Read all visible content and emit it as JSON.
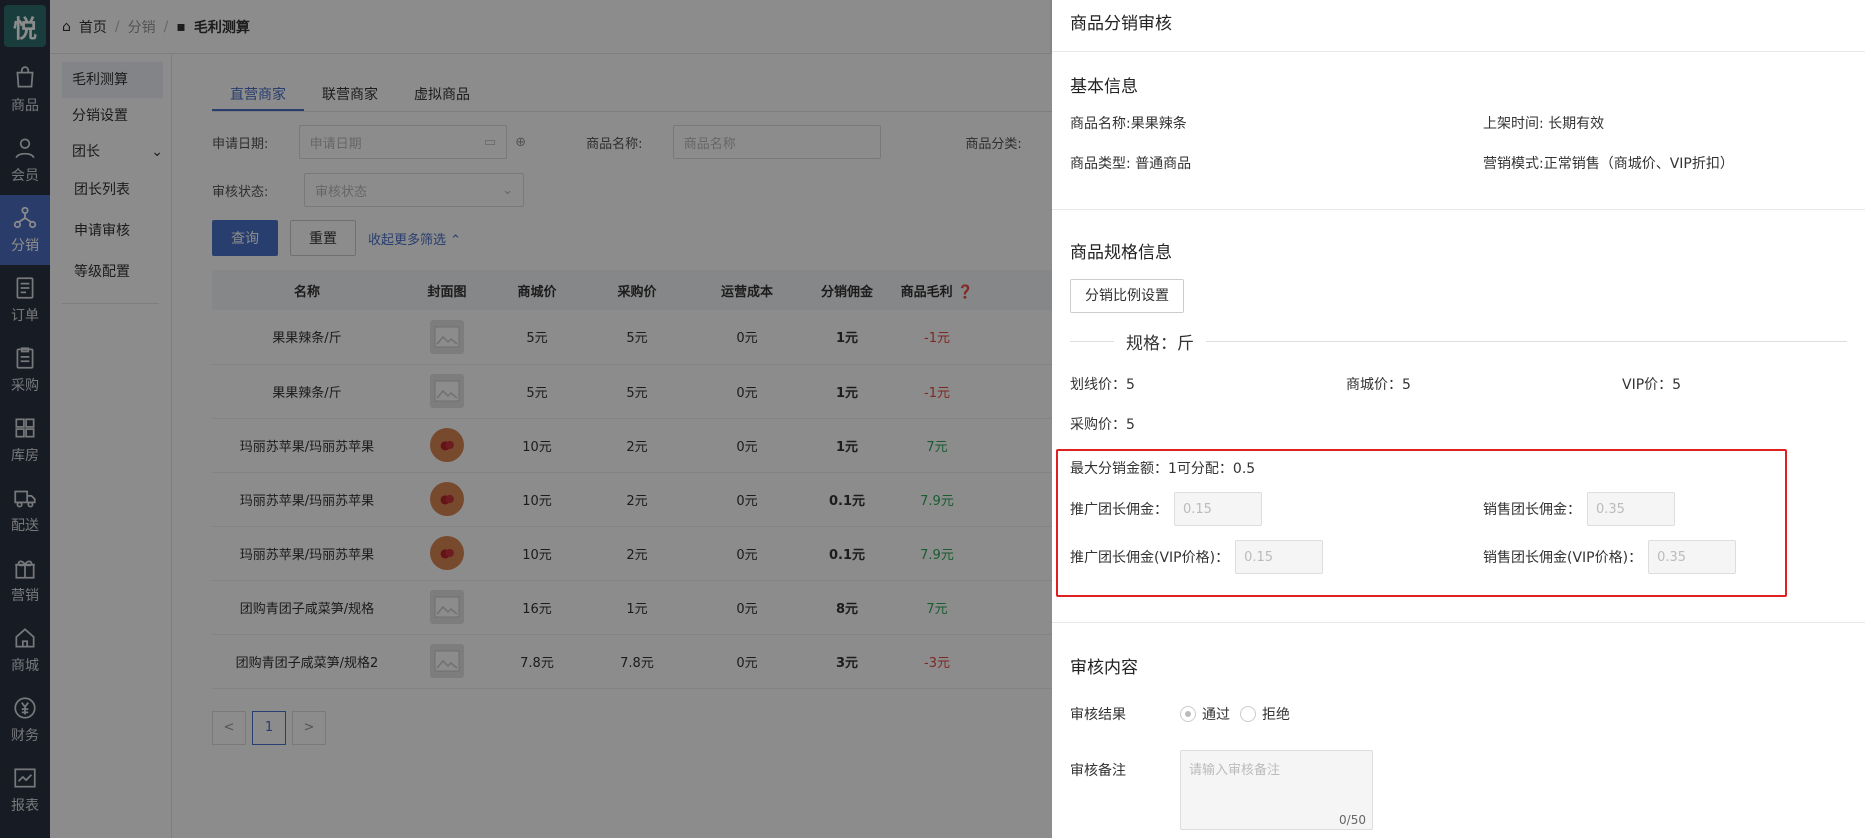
{
  "app": {
    "logo_text": "悦"
  },
  "iconbar": [
    {
      "label": "商品",
      "icon": "bag-icon"
    },
    {
      "label": "会员",
      "icon": "user-icon"
    },
    {
      "label": "分销",
      "icon": "share-icon",
      "active": true
    },
    {
      "label": "订单",
      "icon": "doc-icon"
    },
    {
      "label": "采购",
      "icon": "clipboard-icon"
    },
    {
      "label": "库房",
      "icon": "grid-icon"
    },
    {
      "label": "配送",
      "icon": "truck-icon"
    },
    {
      "label": "营销",
      "icon": "gift-icon"
    },
    {
      "label": "商城",
      "icon": "home-icon"
    },
    {
      "label": "财务",
      "icon": "yen-icon"
    },
    {
      "label": "报表",
      "icon": "chart-icon"
    }
  ],
  "breadcrumb": {
    "home": "首页",
    "parent": "分销",
    "current": "毛利测算"
  },
  "subnav": {
    "items": [
      "毛利测算",
      "分销设置",
      "团长"
    ],
    "children": [
      "团长列表",
      "申请审核",
      "等级配置"
    ]
  },
  "main": {
    "tabs": [
      "直营商家",
      "联营商家",
      "虚拟商品"
    ],
    "filters": {
      "apply_date_label": "申请日期:",
      "apply_date_placeholder": "申请日期",
      "name_label": "商品名称:",
      "name_placeholder": "商品名称",
      "category_label": "商品分类:",
      "status_label": "审核状态:",
      "status_placeholder": "审核状态"
    },
    "buttons": {
      "query": "查询",
      "reset": "重置",
      "collapse": "收起更多筛选"
    },
    "table": {
      "headers": [
        "名称",
        "封面图",
        "商城价",
        "采购价",
        "运营成本",
        "分销佣金",
        "商品毛利"
      ],
      "rows": [
        {
          "name": "果果辣条/斤",
          "cover": "placeholder",
          "price": "5元",
          "purchase": "5元",
          "cost": "0元",
          "commission": "1元",
          "profit": "-1元",
          "tone": "red"
        },
        {
          "name": "果果辣条/斤",
          "cover": "placeholder",
          "price": "5元",
          "purchase": "5元",
          "cost": "0元",
          "commission": "1元",
          "profit": "-1元",
          "tone": "red"
        },
        {
          "name": "玛丽苏苹果/玛丽苏苹果",
          "cover": "apple",
          "price": "10元",
          "purchase": "2元",
          "cost": "0元",
          "commission": "1元",
          "profit": "7元",
          "tone": "green"
        },
        {
          "name": "玛丽苏苹果/玛丽苏苹果",
          "cover": "apple",
          "price": "10元",
          "purchase": "2元",
          "cost": "0元",
          "commission": "0.1元",
          "profit": "7.9元",
          "tone": "green"
        },
        {
          "name": "玛丽苏苹果/玛丽苏苹果",
          "cover": "apple",
          "price": "10元",
          "purchase": "2元",
          "cost": "0元",
          "commission": "0.1元",
          "profit": "7.9元",
          "tone": "green"
        },
        {
          "name": "团购青团子咸菜笋/规格",
          "cover": "placeholder",
          "price": "16元",
          "purchase": "1元",
          "cost": "0元",
          "commission": "8元",
          "profit": "7元",
          "tone": "green"
        },
        {
          "name": "团购青团子咸菜笋/规格2",
          "cover": "placeholder",
          "price": "7.8元",
          "purchase": "7.8元",
          "cost": "0元",
          "commission": "3元",
          "profit": "-3元",
          "tone": "red"
        }
      ]
    },
    "pager": {
      "current": "1",
      "prev": "<",
      "next": ">"
    }
  },
  "drawer": {
    "title": "商品分销审核",
    "basic": {
      "heading": "基本信息",
      "name_label": "商品名称:",
      "name_value": "果果辣条",
      "shelf_label": "上架时间:",
      "shelf_value": "长期有效",
      "type_label": "商品类型:",
      "type_value": "普通商品",
      "mode_label": "营销模式:",
      "mode_value": "正常销售（商城价、VIP折扣）"
    },
    "spec": {
      "heading": "商品规格信息",
      "ratio_button": "分销比例设置",
      "spec_title": "规格：斤",
      "line_price": "划线价：5",
      "mall_price": "商城价：5",
      "vip_price": "VIP价：5",
      "purchase_price": "采购价：5",
      "max_text": "最大分销金额：1可分配：0.5",
      "promo_label": "推广团长佣金：",
      "promo_value": "0.15",
      "sales_label": "销售团长佣金：",
      "sales_value": "0.35",
      "promo_vip_label": "推广团长佣金(VIP价格)：",
      "promo_vip_value": "0.15",
      "sales_vip_label": "销售团长佣金(VIP价格)：",
      "sales_vip_value": "0.35"
    },
    "review": {
      "heading": "审核内容",
      "result_label": "审核结果",
      "pass": "通过",
      "reject": "拒绝",
      "remark_label": "审核备注",
      "remark_placeholder": "请输入审核备注",
      "counter": "0/50"
    }
  }
}
